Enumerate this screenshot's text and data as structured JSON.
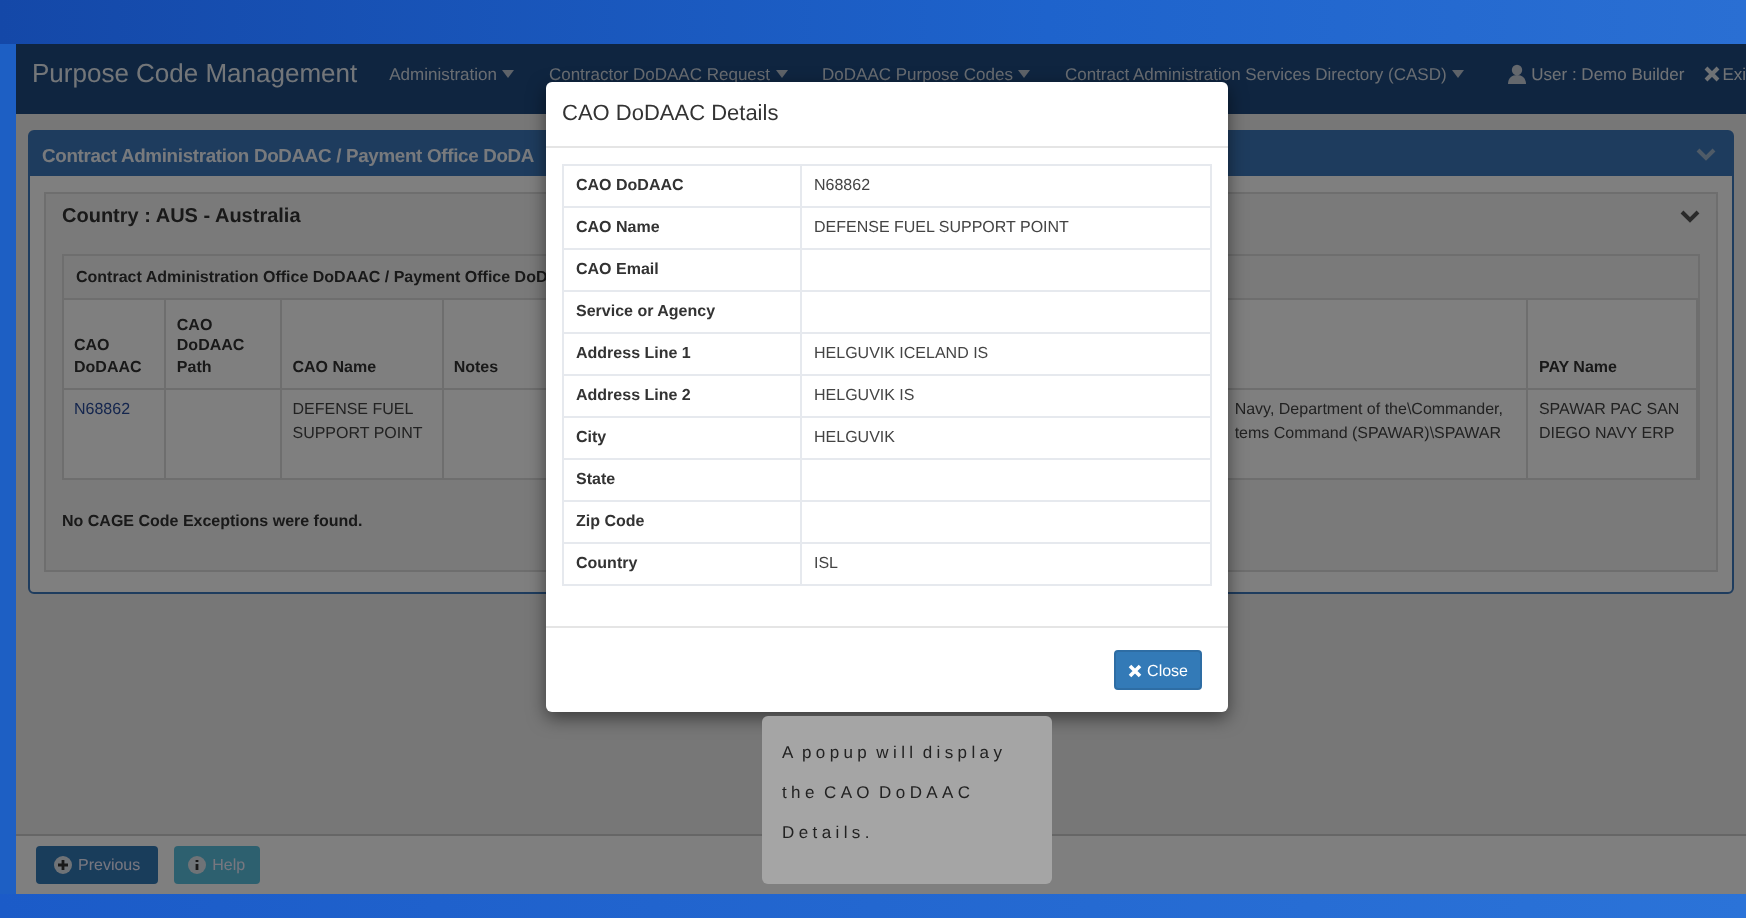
{
  "navbar": {
    "brand": "Purpose Code Management",
    "menus": [
      {
        "label": "Administration"
      },
      {
        "label": "Contractor DoDAAC Request"
      },
      {
        "label": "DoDAAC Purpose Codes"
      },
      {
        "label": "Contract Administration Services Directory (CASD)"
      }
    ],
    "user": "User : Demo Builder",
    "exit": "Exi"
  },
  "panel": {
    "title": "Contract Administration DoDAAC / Payment Office DoDA",
    "country": {
      "title": "Country : AUS - Australia",
      "table": {
        "caption": "Contract Administration Office DoDAAC / Payment Office DoD",
        "columns": [
          "CAO DoDAAC",
          "CAO DoDAAC Path",
          "CAO Name",
          "Notes",
          "",
          "PAY Name"
        ],
        "rows": [
          [
            "N68862",
            "",
            "DEFENSE FUEL SUPPORT POINT",
            "",
            "Navy, Department of the\\Commander, tems Command (SPAWAR)\\SPAWAR",
            "SPAWAR PAC SAN DIEGO NAVY ERP"
          ]
        ]
      },
      "message": "No CAGE Code Exceptions were found."
    }
  },
  "footer": {
    "buttons": [
      {
        "label": "Previous",
        "kind": "primary"
      },
      {
        "label": "Help",
        "kind": "info"
      }
    ]
  },
  "modal": {
    "title": "CAO DoDAAC Details",
    "fields": [
      {
        "label": "CAO DoDAAC",
        "value": "N68862"
      },
      {
        "label": "CAO Name",
        "value": "DEFENSE FUEL SUPPORT POINT"
      },
      {
        "label": "CAO Email"
      },
      {
        "label": "Service or Agency"
      },
      {
        "label": "Address Line 1",
        "value": "HELGUVIK ICELAND IS"
      },
      {
        "label": "Address Line 2",
        "value": "HELGUVIK IS"
      },
      {
        "label": "City",
        "value": "HELGUVIK"
      },
      {
        "label": "State"
      },
      {
        "label": "Zip Code"
      },
      {
        "label": "Country",
        "value": "ISL"
      }
    ],
    "close": "Close"
  },
  "tooltip": "A popup will display the CAO DoDAAC Details."
}
